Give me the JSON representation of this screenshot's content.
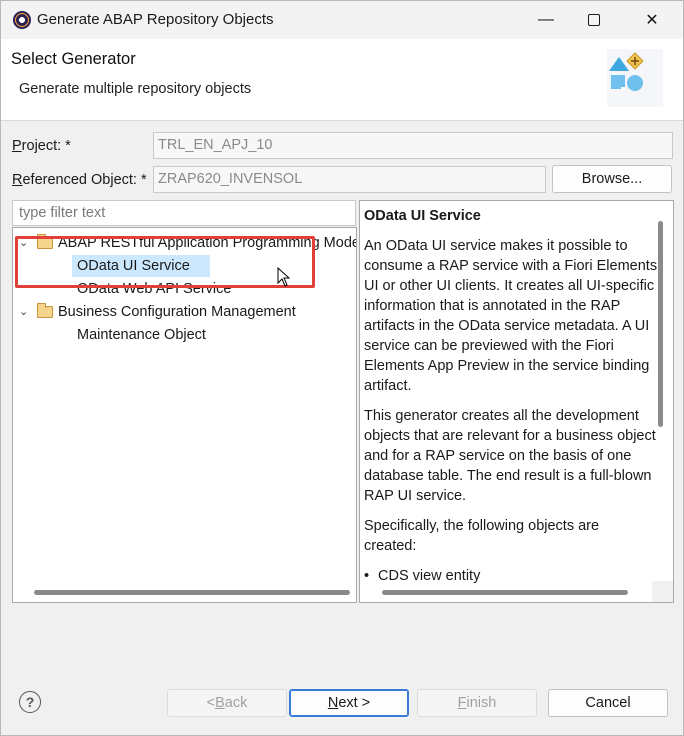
{
  "window": {
    "title": "Generate ABAP Repository Objects",
    "minimize_glyph": "—",
    "close_glyph": "✕"
  },
  "banner": {
    "title": "Select Generator",
    "subtitle": "Generate multiple repository objects"
  },
  "form": {
    "project_label_prefix": "P",
    "project_label_rest": "roject: *",
    "project_value": "TRL_EN_APJ_10",
    "ref_label_prefix": "R",
    "ref_label_rest": "eferenced Object: *",
    "ref_value": "ZRAP620_INVENSOL",
    "browse_label": "Browse..."
  },
  "tree": {
    "filter_placeholder": "type filter text",
    "groups": [
      {
        "label": "ABAP RESTful Application Programming Model",
        "items": [
          "OData UI Service",
          "OData Web API Service"
        ]
      },
      {
        "label": "Business Configuration Management",
        "items": [
          "Maintenance Object"
        ]
      }
    ],
    "selected": "OData UI Service"
  },
  "description": {
    "title": "OData UI Service",
    "para1": [
      "An OData UI service makes it possible to",
      "consume a RAP service with a Fiori Elements",
      "UI or other UI clients. It creates all UI-specific",
      "information that is annotated in the RAP",
      "artifacts in the OData service metadata. A UI",
      "service can be previewed with the Fiori",
      "Elements App Preview in the service binding",
      "artifact."
    ],
    "para2": [
      "This generator creates all the development",
      "objects that are relevant for a business object",
      "and for a RAP service on the basis of one",
      "database table. The end result is a full-blown",
      "RAP UI service."
    ],
    "para3": [
      "Specifically, the following objects are",
      "created:"
    ],
    "bullets": [
      "CDS view entity"
    ]
  },
  "footer": {
    "help_glyph": "?",
    "back_prefix": "< ",
    "back_mnemonic": "B",
    "back_rest": "ack",
    "next_mnemonic": "N",
    "next_rest": "ext >",
    "finish_mnemonic": "F",
    "finish_rest": "inish",
    "cancel_label": "Cancel"
  }
}
